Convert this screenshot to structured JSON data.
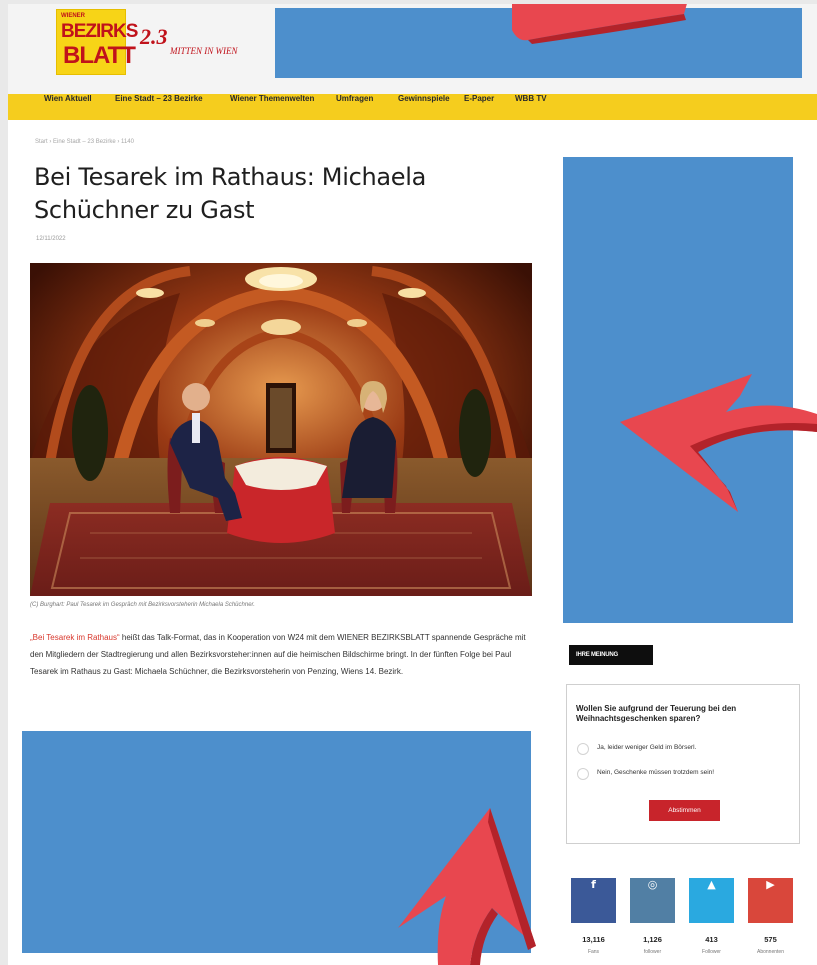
{
  "header": {
    "logo": {
      "line1": "WIENER",
      "line2": "BEZIRKS",
      "line3": "BLATT"
    },
    "promo": {
      "big": "2.3",
      "small": "MITTEN IN WIEN"
    }
  },
  "nav": {
    "items": [
      "Wien Aktuell",
      "Eine Stadt – 23 Bezirke",
      "Wiener Themenwelten",
      "Umfragen",
      "Gewinnspiele",
      "E-Paper",
      "WBB TV"
    ]
  },
  "article": {
    "breadcrumb": "Start  ›  Eine Stadt – 23 Bezirke  ›  1140",
    "title": "Bei Tesarek im Rathaus: Michaela Schüchner zu Gast",
    "date": "12/11/2022",
    "caption": "(C) Burghart: Paul Tesarek im Gespräch mit Bezirksvorsteherin Michaela Schüchner.",
    "para_highlight": "„Bei Tesarek im Rathaus“",
    "para_rest": " heißt das Talk-Format, das in Kooperation von W24 mit dem WIENER BEZIRKSBLATT spannende Gespräche mit den Mitgliedern der Stadtregierung und allen Bezirksvorsteher:innen auf die heimischen Bildschirme bringt. In der fünften Folge bei Paul Tesarek im Rathaus zu Gast: Michaela Schüchner, die Bezirksvorsteherin von Penzing, Wiens 14. Bezirk."
  },
  "poll": {
    "label": "IHRE MEINUNG",
    "question": "Wollen Sie aufgrund der Teuerung bei den Weihnachtsgeschenken sparen?",
    "options": [
      "Ja, leider weniger Geld im Börserl.",
      "Nein, Geschenke müssen trotzdem sein!"
    ],
    "button": "Abstimmen"
  },
  "social": [
    {
      "icon": "facebook-icon",
      "glyph": "f",
      "count": "13,116",
      "label": "Fans",
      "color": "#3b5998"
    },
    {
      "icon": "instagram-icon",
      "glyph": "◎",
      "count": "1,126",
      "label": "follower",
      "color": "#517fa4"
    },
    {
      "icon": "twitter-icon",
      "glyph": "▲",
      "count": "413",
      "label": "Follower",
      "color": "#2aa9e0"
    },
    {
      "icon": "youtube-icon",
      "glyph": "▶",
      "count": "575",
      "label": "Abonnenten",
      "color": "#d9473b"
    }
  ],
  "colors": {
    "ad_placeholder": "#4d8fcc",
    "nav": "#f5cd1e",
    "brand_red": "#c0121b",
    "arrow": "#e8474f"
  }
}
